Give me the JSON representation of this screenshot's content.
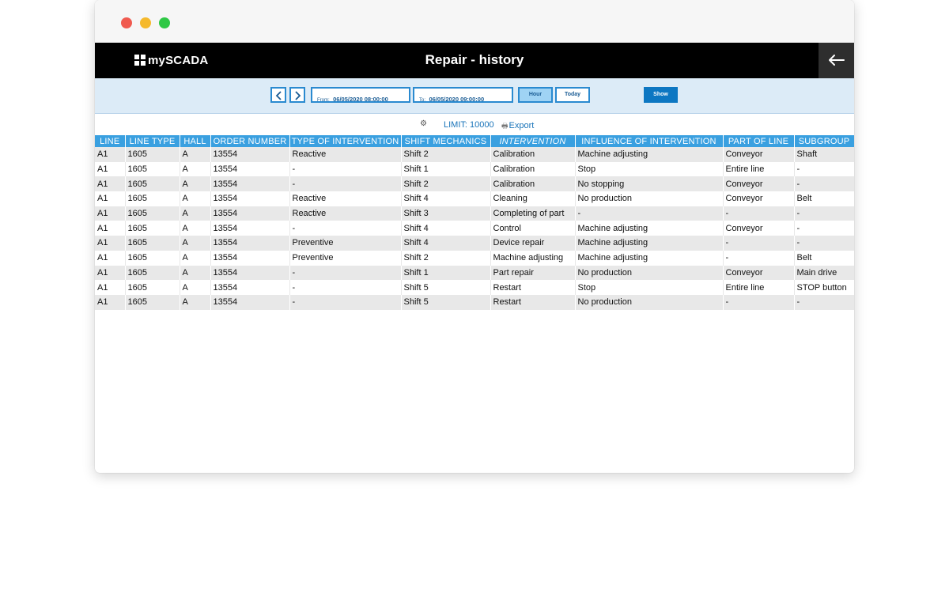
{
  "window": {
    "controls": [
      "close",
      "minimize",
      "maximize"
    ]
  },
  "header": {
    "logo_text": "mySCADA",
    "title": "Repair - history",
    "back_icon": "arrow-left-icon"
  },
  "toolbar": {
    "from_label": "From:",
    "from_value": "06/05/2020 08:00:00",
    "to_label": "To:",
    "to_value": "06/05/2020 09:00:00",
    "hour_label": "Hour",
    "today_label": "Today",
    "show_label": "Show",
    "prev_icon": "chevron-left-icon",
    "next_icon": "chevron-right-icon"
  },
  "info": {
    "settings_icon": "gear-icon",
    "limit_text": "LIMIT: 10000",
    "export_label": "Export",
    "export_icon": "print-icon"
  },
  "colors": {
    "header_bg": "#000000",
    "toolbar_bg": "#dcebf7",
    "accent": "#0d77c2",
    "table_header": "#3aa0e0",
    "row_alt": "#e8e8e8"
  },
  "table": {
    "columns": [
      "LINE",
      "LINE TYPE",
      "HALL",
      "ORDER NUMBER",
      "TYPE OF INTERVENTION",
      "SHIFT MECHANICS",
      "INTERVENTION",
      "INFLUENCE OF INTERVENTION",
      "PART OF LINE",
      "SUBGROUP"
    ],
    "rows": [
      [
        "A1",
        "1605",
        "A",
        "13554",
        "Reactive",
        "Shift 2",
        "Calibration",
        "Machine adjusting",
        "Conveyor",
        "Shaft"
      ],
      [
        "A1",
        "1605",
        "A",
        "13554",
        "-",
        "Shift 1",
        "Calibration",
        "Stop",
        "Entire line",
        "-"
      ],
      [
        "A1",
        "1605",
        "A",
        "13554",
        "-",
        "Shift 2",
        "Calibration",
        "No stopping",
        "Conveyor",
        "-"
      ],
      [
        "A1",
        "1605",
        "A",
        "13554",
        "Reactive",
        "Shift 4",
        "Cleaning",
        "No production",
        "Conveyor",
        "Belt"
      ],
      [
        "A1",
        "1605",
        "A",
        "13554",
        "Reactive",
        "Shift 3",
        "Completing of part",
        "-",
        "-",
        "-"
      ],
      [
        "A1",
        "1605",
        "A",
        "13554",
        "-",
        "Shift 4",
        "Control",
        "Machine adjusting",
        "Conveyor",
        "-"
      ],
      [
        "A1",
        "1605",
        "A",
        "13554",
        "Preventive",
        "Shift 4",
        "Device repair",
        "Machine adjusting",
        "-",
        "-"
      ],
      [
        "A1",
        "1605",
        "A",
        "13554",
        "Preventive",
        "Shift 2",
        "Machine adjusting",
        "Machine adjusting",
        "-",
        "Belt"
      ],
      [
        "A1",
        "1605",
        "A",
        "13554",
        "-",
        "Shift 1",
        "Part repair",
        "No production",
        "Conveyor",
        "Main drive"
      ],
      [
        "A1",
        "1605",
        "A",
        "13554",
        "-",
        "Shift 5",
        "Restart",
        "Stop",
        "Entire line",
        "STOP button"
      ],
      [
        "A1",
        "1605",
        "A",
        "13554",
        "-",
        "Shift 5",
        "Restart",
        "No production",
        "-",
        "-"
      ]
    ]
  }
}
